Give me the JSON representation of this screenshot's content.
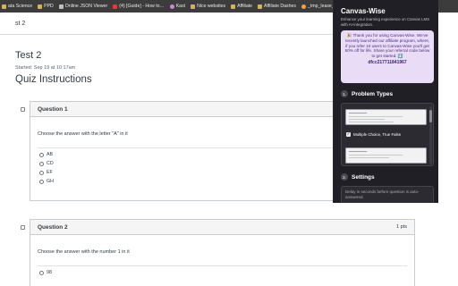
{
  "bookmarks": [
    {
      "label": "ata Science",
      "icon": "folder-icon"
    },
    {
      "label": "PPD",
      "icon": "folder-icon"
    },
    {
      "label": "Online JSON Viewer",
      "icon": "page-icon"
    },
    {
      "label": "(4) [Guide] - How to…",
      "icon": "youtube-icon"
    },
    {
      "label": "Kast",
      "icon": "heart-icon"
    },
    {
      "label": "Nice websites",
      "icon": "folder-icon"
    },
    {
      "label": "Affiliate",
      "icon": "folder-icon"
    },
    {
      "label": "Affiliate Dashes",
      "icon": "folder-icon"
    },
    {
      "label": "_tmp_lease_docu…",
      "icon": "shop-icon"
    }
  ],
  "page": {
    "breadcrumb": "st 2",
    "title": "Test 2",
    "started": "Started: Sep 19 at 10:17am",
    "instructions": "Quiz Instructions"
  },
  "questions": [
    {
      "title": "Question 1",
      "points": "",
      "text": "Choose the answer with the letter \"A\" in it",
      "options": [
        "AB",
        "CD",
        "EF",
        "GH"
      ]
    },
    {
      "title": "Question 2",
      "points": "1 pts",
      "text": "Choose the answer with the number 1 in it",
      "options": [
        "98"
      ]
    }
  ],
  "extension": {
    "title": "Canvas-Wise",
    "subtitle": "Enhance your learning experience on Canvas LMS with AI-integration.",
    "promo": "🎉 Thank you for using Canvas-Wise. We've recently launched our affiliate program, where, if you refer 10 users to Canvas-Wise you'll get 50% off for life. Share your referral code below to get started. ⬇️",
    "promo_code": "dfcc217711841967",
    "sections": [
      {
        "num": "1.",
        "label": "Problem Types"
      },
      {
        "num": "2.",
        "label": "Settings"
      }
    ],
    "problem_type_label": "Multiple Choice, True False",
    "checkbox_checked": true,
    "delay_label": "Delay in seconds before question is auto-answered."
  }
}
